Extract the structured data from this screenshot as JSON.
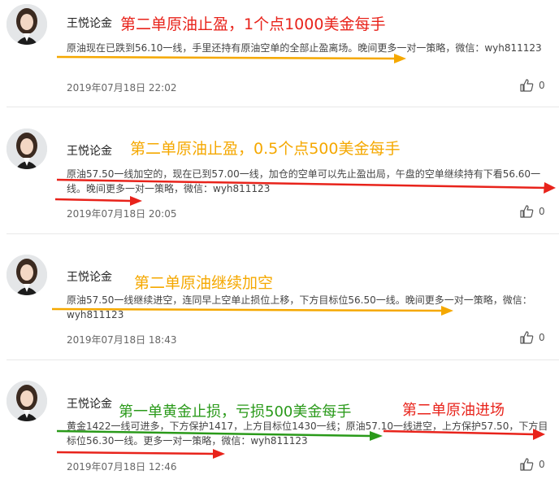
{
  "posts": [
    {
      "author": "王悦论金",
      "headlines": [
        {
          "text": "第二单原油止盈，1个点1000美金每手",
          "color": "#e8231b"
        }
      ],
      "body": "原油现在已跌到56.10一线，手里还持有原油空单的全部止盈离场。晚间更多一对一策略，微信：wyh811123",
      "time": "2019年07月18日 22:02",
      "likes": "0"
    },
    {
      "author": "王悦论金",
      "headlines": [
        {
          "text": "第二单原油止盈，0.5个点500美金每手",
          "color": "#f5a800"
        }
      ],
      "body": "原油57.50一线加空的，现在已到57.00一线，加仓的空单可以先止盈出局，午盘的空单继续持有下看56.60一线。晚间更多一对一策略，微信：wyh811123",
      "time": "2019年07月18日 20:05",
      "likes": "0"
    },
    {
      "author": "王悦论金",
      "headlines": [
        {
          "text": "第二单原油继续加空",
          "color": "#f5a800"
        }
      ],
      "body": "原油57.50一线继续进空，连同早上空单止损位上移，下方目标位56.50一线。晚间更多一对一策略，微信：wyh811123",
      "time": "2019年07月18日 18:43",
      "likes": "0"
    },
    {
      "author": "王悦论金",
      "headlines": [
        {
          "text": "第一单黄金止损，亏损500美金每手",
          "color": "#2a9a1a"
        },
        {
          "text": "第二单原油进场",
          "color": "#e8231b"
        }
      ],
      "body": "黄金1422一线可进多，下方保护1417，上方目标位1430一线；原油57.10一线进空，上方保护57.50，下方目标位56.30一线。更多一对一策略，微信：wyh811123",
      "time": "2019年07月18日 12:46",
      "likes": "0"
    }
  ]
}
